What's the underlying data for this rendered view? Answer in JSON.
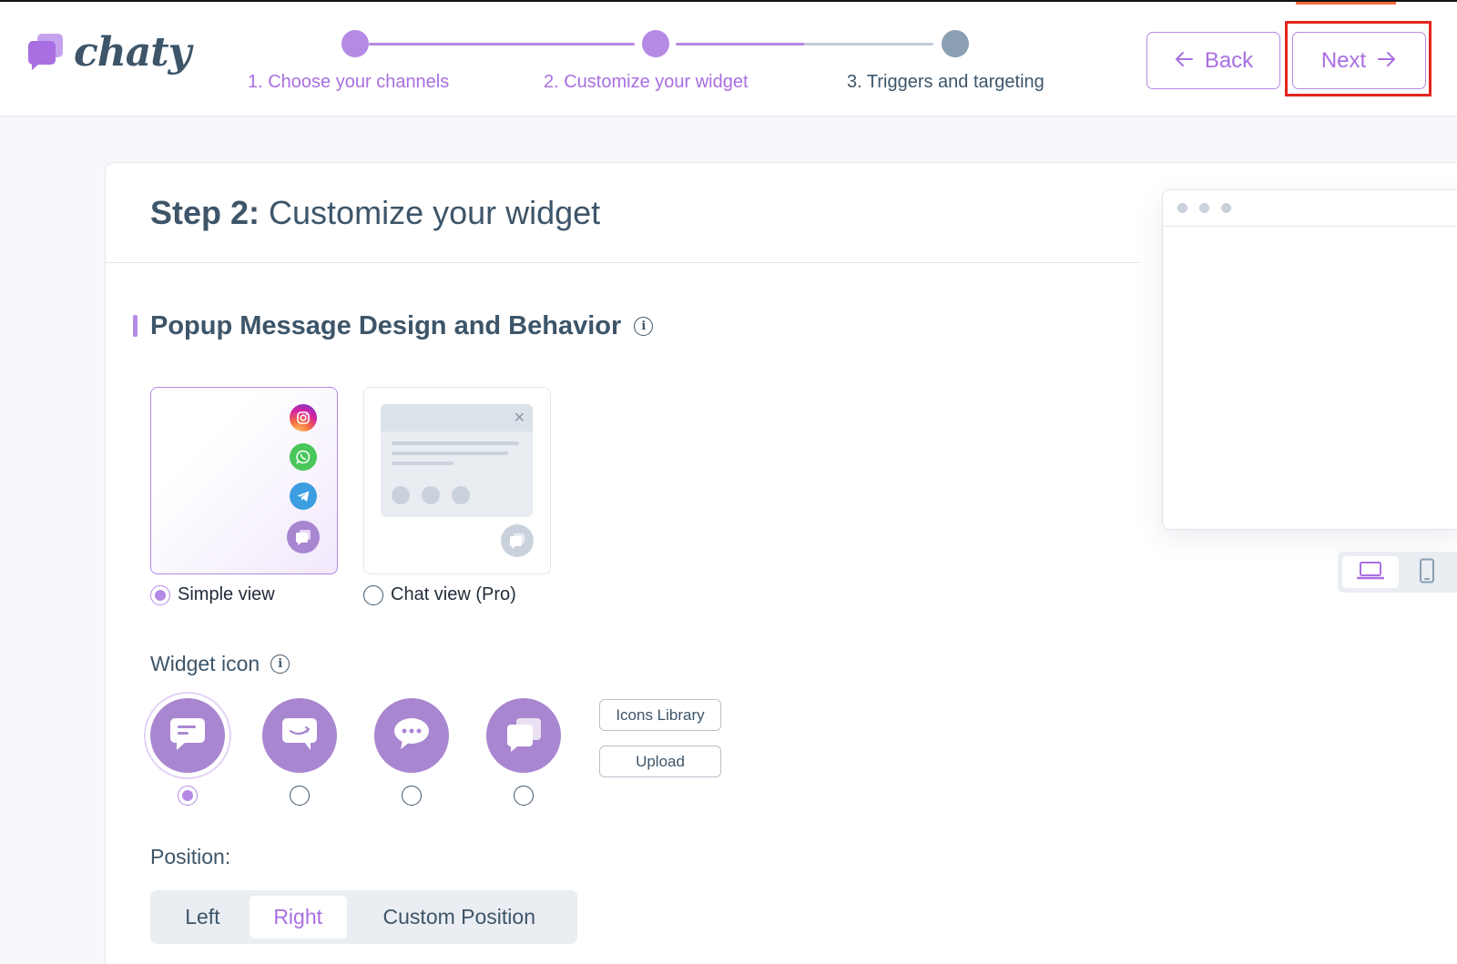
{
  "app": {
    "logo_text": "chaty"
  },
  "stepper": {
    "steps": [
      {
        "label": "1. Choose your channels",
        "state": "done"
      },
      {
        "label": "2. Customize your widget",
        "state": "current"
      },
      {
        "label": "3. Triggers and targeting",
        "state": "upcoming"
      }
    ]
  },
  "nav": {
    "back_label": "Back",
    "next_label": "Next"
  },
  "page": {
    "title_bold": "Step 2:",
    "title_rest": " Customize your widget"
  },
  "popup_section": {
    "title": "Popup Message Design and Behavior",
    "views": [
      {
        "label": "Simple view",
        "selected": true
      },
      {
        "label": "Chat view (Pro)",
        "selected": false
      }
    ]
  },
  "widget_icon": {
    "label": "Widget icon",
    "options": [
      "chat-bubble-lines",
      "chat-bubble-smile",
      "chat-bubble-dots",
      "chat-bubbles-stacked"
    ],
    "selected_index": 0,
    "icons_library_label": "Icons Library",
    "upload_label": "Upload"
  },
  "position": {
    "label": "Position:",
    "options": [
      "Left",
      "Right",
      "Custom Position"
    ],
    "selected": "Right"
  },
  "preview": {
    "device_selected": "desktop"
  },
  "colors": {
    "accent": "#a96fe2",
    "accent_light": "#b48ae4",
    "widget_bg": "#a986d0",
    "text_dark": "#3d5569",
    "highlight": "#e5261f"
  }
}
